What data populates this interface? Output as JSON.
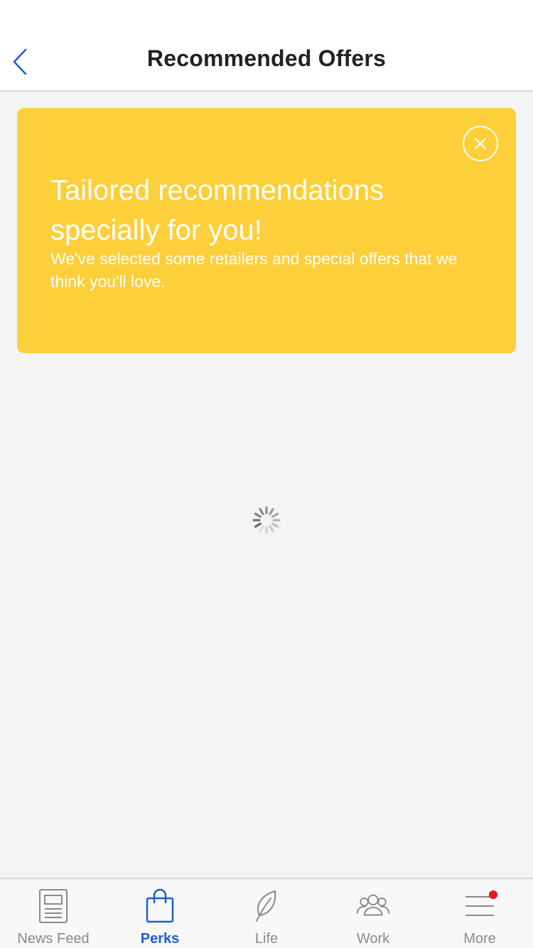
{
  "header": {
    "title": "Recommended Offers",
    "back_icon": "chevron-left-icon"
  },
  "promo": {
    "heading": "Tailored recommendations specially for you!",
    "body": "We've selected some retailers and special offers that we think you'll love.",
    "close_icon": "close-icon",
    "color": "#fdcf3a"
  },
  "content": {
    "loading_icon": "spinner-icon"
  },
  "tabbar": {
    "active_color": "#1a5fd1",
    "inactive_color": "#8a8a8a",
    "tabs": [
      {
        "label": "News Feed",
        "icon": "newspaper-icon",
        "active": false
      },
      {
        "label": "Perks",
        "icon": "shopping-bag-icon",
        "active": true
      },
      {
        "label": "Life",
        "icon": "leaf-icon",
        "active": false
      },
      {
        "label": "Work",
        "icon": "people-icon",
        "active": false
      },
      {
        "label": "More",
        "icon": "menu-icon",
        "active": false,
        "badge": true
      }
    ]
  }
}
